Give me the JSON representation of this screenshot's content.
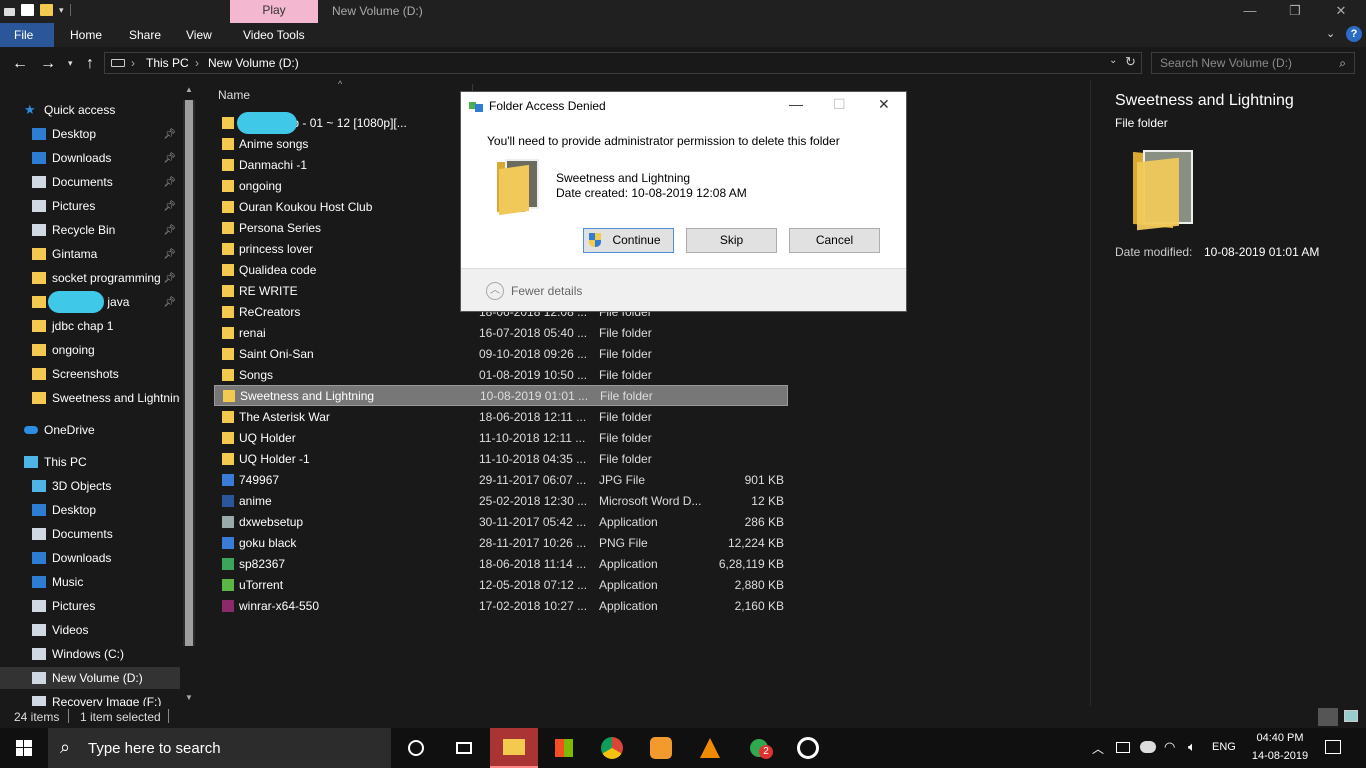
{
  "titlebar": {
    "context_tab": "Play",
    "title": "New Volume (D:)"
  },
  "ribbon": {
    "tabs": [
      "File",
      "Home",
      "Share",
      "View",
      "Video Tools"
    ]
  },
  "address": {
    "crumbs": [
      "This PC",
      "New Volume (D:)"
    ],
    "search_placeholder": "Search New Volume (D:)"
  },
  "nav": {
    "quick_access": "Quick access",
    "items": [
      {
        "label": "Desktop",
        "pinned": true,
        "icon": "desktop-icon",
        "color": "#2d7dd2"
      },
      {
        "label": "Downloads",
        "pinned": true,
        "icon": "download-arrow-icon",
        "color": "#2d7dd2"
      },
      {
        "label": "Documents",
        "pinned": true,
        "icon": "document-icon",
        "color": "#cfd8e3"
      },
      {
        "label": "Pictures",
        "pinned": true,
        "icon": "picture-icon",
        "color": "#cfd8e3"
      },
      {
        "label": "Recycle Bin",
        "pinned": true,
        "icon": "recycle-bin-icon",
        "color": "#cfd8e3"
      },
      {
        "label": "Gintama",
        "pinned": true,
        "icon": "folder-icon",
        "color": "#f3c94f"
      },
      {
        "label": "socket programming",
        "pinned": true,
        "icon": "folder-icon",
        "color": "#f3c94f"
      },
      {
        "label": "advanced java",
        "pinned": true,
        "icon": "folder-icon",
        "color": "#f3c94f"
      },
      {
        "label": "jdbc chap 1",
        "pinned": false,
        "icon": "folder-icon",
        "color": "#f3c94f"
      },
      {
        "label": "ongoing",
        "pinned": false,
        "icon": "folder-icon",
        "color": "#f3c94f"
      },
      {
        "label": "Screenshots",
        "pinned": false,
        "icon": "folder-icon",
        "color": "#f3c94f"
      },
      {
        "label": "Sweetness and Lightning",
        "pinned": false,
        "icon": "folder-icon",
        "color": "#f3c94f"
      }
    ],
    "onedrive": "OneDrive",
    "thispc": "This PC",
    "pc_items": [
      {
        "label": "3D Objects",
        "icon": "cube-icon",
        "color": "#4fb5e6"
      },
      {
        "label": "Desktop",
        "icon": "desktop-icon",
        "color": "#2d7dd2"
      },
      {
        "label": "Documents",
        "icon": "document-icon",
        "color": "#cfd8e3"
      },
      {
        "label": "Downloads",
        "icon": "download-arrow-icon",
        "color": "#2d7dd2"
      },
      {
        "label": "Music",
        "icon": "music-note-icon",
        "color": "#2d7dd2"
      },
      {
        "label": "Pictures",
        "icon": "picture-icon",
        "color": "#cfd8e3"
      },
      {
        "label": "Videos",
        "icon": "video-icon",
        "color": "#cfd8e3"
      },
      {
        "label": "Windows (C:)",
        "icon": "drive-icon",
        "color": "#cfd8e3"
      },
      {
        "label": "New Volume (D:)",
        "icon": "drive-icon",
        "color": "#cfd8e3"
      },
      {
        "label": "Recovery Image (F:)",
        "icon": "drive-icon",
        "color": "#cfd8e3"
      }
    ]
  },
  "filelist": {
    "headers": {
      "name": "Name"
    },
    "rows": [
      {
        "name": "Yuru Camp - 01 ~ 12 [1080p][...",
        "date": "",
        "type": "",
        "size": "",
        "icon": "folder-icon"
      },
      {
        "name": "Anime songs",
        "date": "",
        "type": "",
        "size": "",
        "icon": "folder-icon"
      },
      {
        "name": "Danmachi -1",
        "date": "",
        "type": "",
        "size": "",
        "icon": "folder-icon"
      },
      {
        "name": "ongoing",
        "date": "",
        "type": "",
        "size": "",
        "icon": "folder-icon"
      },
      {
        "name": "Ouran Koukou Host Club",
        "date": "",
        "type": "",
        "size": "",
        "icon": "folder-icon"
      },
      {
        "name": "Persona Series",
        "date": "",
        "type": "",
        "size": "",
        "icon": "folder-icon"
      },
      {
        "name": "princess lover",
        "date": "",
        "type": "",
        "size": "",
        "icon": "folder-icon"
      },
      {
        "name": "Qualidea code",
        "date": "",
        "type": "",
        "size": "",
        "icon": "folder-icon"
      },
      {
        "name": "RE WRITE",
        "date": "",
        "type": "",
        "size": "",
        "icon": "folder-icon"
      },
      {
        "name": "ReCreators",
        "date": "18-06-2018 12:08 ...",
        "type": "File folder",
        "size": "",
        "icon": "folder-icon"
      },
      {
        "name": "renai",
        "date": "16-07-2018 05:40 ...",
        "type": "File folder",
        "size": "",
        "icon": "folder-icon"
      },
      {
        "name": "Saint Oni-San",
        "date": "09-10-2018 09:26 ...",
        "type": "File folder",
        "size": "",
        "icon": "folder-icon"
      },
      {
        "name": "Songs",
        "date": "01-08-2019 10:50 ...",
        "type": "File folder",
        "size": "",
        "icon": "folder-icon"
      },
      {
        "name": "Sweetness and Lightning",
        "date": "10-08-2019 01:01 ...",
        "type": "File folder",
        "size": "",
        "icon": "folder-icon",
        "selected": true
      },
      {
        "name": "The Asterisk War",
        "date": "18-06-2018 12:11 ...",
        "type": "File folder",
        "size": "",
        "icon": "folder-icon"
      },
      {
        "name": "UQ Holder",
        "date": "11-10-2018 12:11 ...",
        "type": "File folder",
        "size": "",
        "icon": "folder-icon"
      },
      {
        "name": "UQ Holder -1",
        "date": "11-10-2018 04:35 ...",
        "type": "File folder",
        "size": "",
        "icon": "folder-icon"
      },
      {
        "name": "749967",
        "date": "29-11-2017 06:07 ...",
        "type": "JPG File",
        "size": "901 KB",
        "icon": "image-file-icon"
      },
      {
        "name": "anime",
        "date": "25-02-2018 12:30 ...",
        "type": "Microsoft Word D...",
        "size": "12 KB",
        "icon": "word-document-icon"
      },
      {
        "name": "dxwebsetup",
        "date": "30-11-2017 05:42 ...",
        "type": "Application",
        "size": "286 KB",
        "icon": "setup-app-icon"
      },
      {
        "name": "goku black",
        "date": "28-11-2017 10:26 ...",
        "type": "PNG File",
        "size": "12,224 KB",
        "icon": "image-file-icon"
      },
      {
        "name": "sp82367",
        "date": "18-06-2018 11:14 ...",
        "type": "Application",
        "size": "6,28,119 KB",
        "icon": "app-icon"
      },
      {
        "name": "uTorrent",
        "date": "12-05-2018 07:12 ...",
        "type": "Application",
        "size": "2,880 KB",
        "icon": "utorrent-icon"
      },
      {
        "name": "winrar-x64-550",
        "date": "17-02-2018 10:27 ...",
        "type": "Application",
        "size": "2,160 KB",
        "icon": "winrar-icon"
      }
    ]
  },
  "preview": {
    "title": "Sweetness and Lightning",
    "subtitle": "File folder",
    "meta_label": "Date modified:",
    "meta_value": "10-08-2019 01:01 AM"
  },
  "dialog": {
    "title": "Folder Access Denied",
    "message": "You'll need to provide administrator permission to delete this folder",
    "item_name": "Sweetness and Lightning",
    "item_date": "Date created: 10-08-2019 12:08 AM",
    "continue": "Continue",
    "skip": "Skip",
    "cancel": "Cancel",
    "fewer_details": "Fewer details"
  },
  "status": {
    "count": "24 items",
    "selected": "1 item selected"
  },
  "taskbar": {
    "search_placeholder": "Type here to search",
    "language": "ENG",
    "time": "04:40 PM",
    "date": "14-08-2019",
    "whatsapp_badge": "2"
  }
}
